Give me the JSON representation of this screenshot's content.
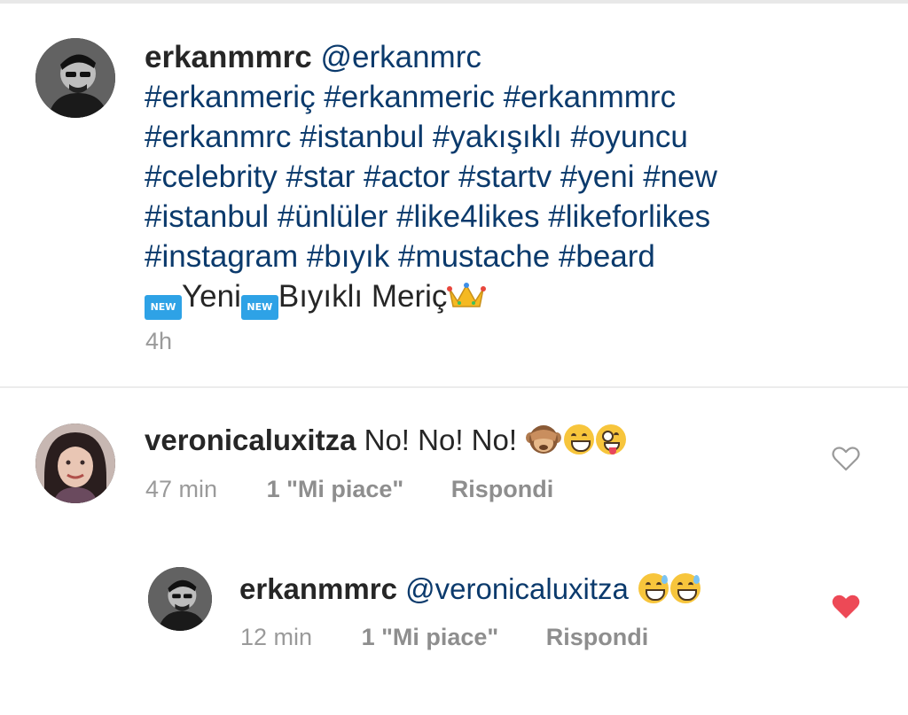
{
  "post": {
    "username": "erkanmmrc",
    "handle": "@erkanmrc",
    "hashtags_line1": "#erkanmeriç #erkanmeric #erkanmmrc",
    "hashtags_line2": "#erkanmrc #istanbul #yakışıklı #oyuncu",
    "hashtags_line3": "#celebrity #star #actor #startv #yeni #new",
    "hashtags_line4": "#istanbul #ünlüler #like4likes #likeforlikes",
    "hashtags_line5": "#instagram #bıyık #mustache #beard",
    "new_badge": "NEW",
    "text_part1": "Yeni",
    "text_part2": "Bıyıklı Meriç",
    "time": "4h"
  },
  "comments": [
    {
      "username": "veronicaluxitza",
      "text": "No! No! No!",
      "time": "47 min",
      "likes": "1 \"Mi piace\"",
      "reply_label": "Rispondi",
      "liked": false
    },
    {
      "username": "erkanmmrc",
      "text": "@veronicaluxitza",
      "time": "12 min",
      "likes": "1 \"Mi piace\"",
      "reply_label": "Rispondi",
      "liked": true
    }
  ],
  "colors": {
    "hashtag": "#0b3a6c",
    "liked_heart": "#ed4956",
    "meta": "#9a9a9a"
  },
  "icons": [
    "heart-outline-icon",
    "heart-filled-icon",
    "new-badge-icon",
    "crown-emoji-icon",
    "see-no-evil-monkey-emoji-icon",
    "grinning-emoji-icon",
    "zany-emoji-icon",
    "sweat-smile-emoji-icon"
  ]
}
